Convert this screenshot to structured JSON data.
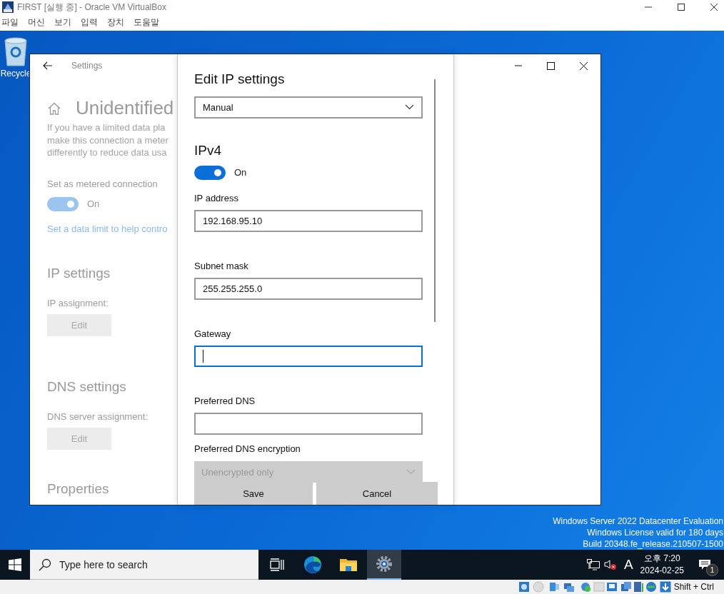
{
  "vbox_window": {
    "title": "FIRST [실행 중] - Oracle VM VirtualBox",
    "menu": [
      "파일",
      "머신",
      "보기",
      "입력",
      "장치",
      "도움말"
    ]
  },
  "desktop": {
    "recycle_bin": "Recycle",
    "watermark": [
      "Windows Server 2022 Datacenter Evaluation",
      "Windows License valid for 180 days",
      "Build 20348.fe_release.210507-1500"
    ]
  },
  "settings_window": {
    "title": "Settings",
    "page_title": "Unidentified",
    "description": [
      "If you have a limited data pla",
      "make this connection a meter",
      "differently to reduce data usa"
    ],
    "metered": {
      "label": "Set as metered connection",
      "on": true,
      "state_text": "On"
    },
    "link": "Set a data limit to help contro",
    "ip_settings": {
      "heading": "IP settings",
      "label": "IP assignment:",
      "button": "Edit"
    },
    "dns_settings": {
      "heading": "DNS settings",
      "label": "DNS server assignment:",
      "button": "Edit"
    },
    "properties_heading": "Properties"
  },
  "edit_dialog": {
    "title": "Edit IP settings",
    "mode": "Manual",
    "section": "IPv4",
    "ipv4": {
      "on": true,
      "state_text": "On"
    },
    "fields": [
      {
        "label": "IP address",
        "value": "192.168.95.10",
        "focused": false
      },
      {
        "label": "Subnet mask",
        "value": "255.255.255.0",
        "focused": false
      },
      {
        "label": "Gateway",
        "focused": true
      },
      {
        "label": "Preferred DNS",
        "focused": false
      }
    ],
    "encryption": {
      "label": "Preferred DNS encryption",
      "value": "Unencrypted only",
      "disabled": true
    },
    "buttons": [
      "Save",
      "Cancel"
    ]
  },
  "taskbar": {
    "search_placeholder": "Type here to search",
    "apps": [
      {
        "kind": "taskview",
        "selected": false
      },
      {
        "kind": "edge",
        "selected": false
      },
      {
        "kind": "explorer",
        "selected": false
      },
      {
        "kind": "settings",
        "selected": true
      }
    ],
    "ime": "A",
    "time": "오후 7:20",
    "date": "2024-02-25",
    "notifications": "1"
  },
  "status_bar": {
    "host_key": "Shift + Ctrl"
  }
}
